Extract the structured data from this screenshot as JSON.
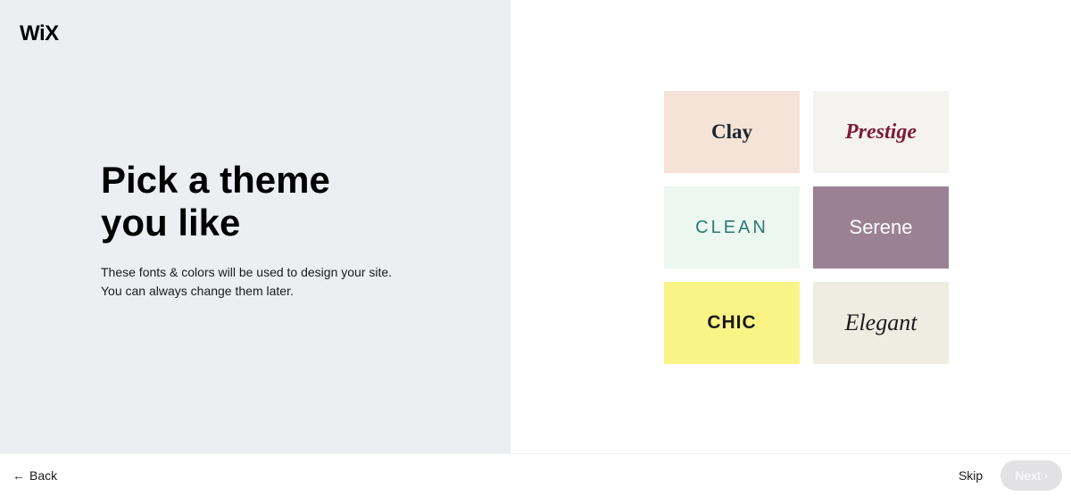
{
  "logo": "WiX",
  "heading": "Pick a theme you like",
  "subtext": "These fonts & colors will be used to design your site. You can always change them later.",
  "themes": [
    {
      "label": "Clay"
    },
    {
      "label": "Prestige"
    },
    {
      "label": "CLEAN"
    },
    {
      "label": "Serene"
    },
    {
      "label": "CHIC"
    },
    {
      "label": "Elegant"
    }
  ],
  "footer": {
    "back": "Back",
    "skip": "Skip",
    "next": "Next"
  }
}
